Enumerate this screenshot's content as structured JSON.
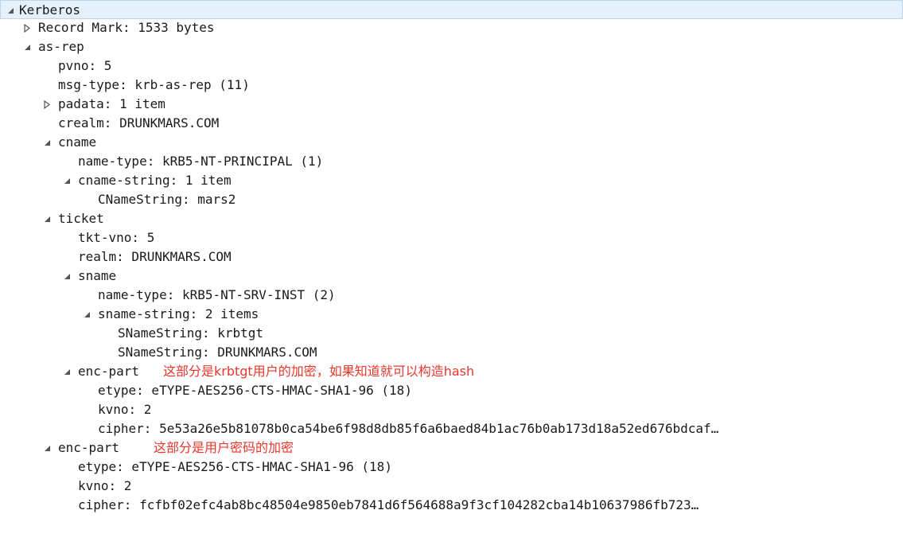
{
  "tree": {
    "root": "Kerberos",
    "record_mark": "Record Mark: 1533 bytes",
    "as_rep": "as-rep",
    "pvno": "pvno: 5",
    "msg_type": "msg-type: krb-as-rep (11)",
    "padata": "padata: 1 item",
    "crealm": "crealm: DRUNKMARS.COM",
    "cname": "cname",
    "cname_name_type": "name-type: kRB5-NT-PRINCIPAL (1)",
    "cname_string": "cname-string: 1 item",
    "cname_string_value": "CNameString: mars2",
    "ticket": "ticket",
    "tkt_vno": "tkt-vno: 5",
    "realm": "realm: DRUNKMARS.COM",
    "sname": "sname",
    "sname_name_type": "name-type: kRB5-NT-SRV-INST (2)",
    "sname_string": "sname-string: 2 items",
    "sname_string_1": "SNameString: krbtgt",
    "sname_string_2": "SNameString: DRUNKMARS.COM",
    "ticket_enc_part": "enc-part",
    "ticket_etype": "etype: eTYPE-AES256-CTS-HMAC-SHA1-96 (18)",
    "ticket_kvno": "kvno: 2",
    "ticket_cipher": "cipher: 5e53a26e5b81078b0ca54be6f98d8db85f6a6baed84b1ac76b0ab173d18a52ed676bdcaf…",
    "enc_part": "enc-part",
    "enc_etype": "etype: eTYPE-AES256-CTS-HMAC-SHA1-96 (18)",
    "enc_kvno": "kvno: 2",
    "enc_cipher": "cipher: fcfbf02efc4ab8bc48504e9850eb7841d6f564688a9f3cf104282cba14b10637986fb723…"
  },
  "annotations": {
    "ticket_enc_note": "这部分是krbtgt用户的加密，如果知道就可以构造hash",
    "enc_part_note": "这部分是用户密码的加密"
  },
  "colors": {
    "annotation": "#e8372b",
    "selection": "#e6f0fb"
  }
}
